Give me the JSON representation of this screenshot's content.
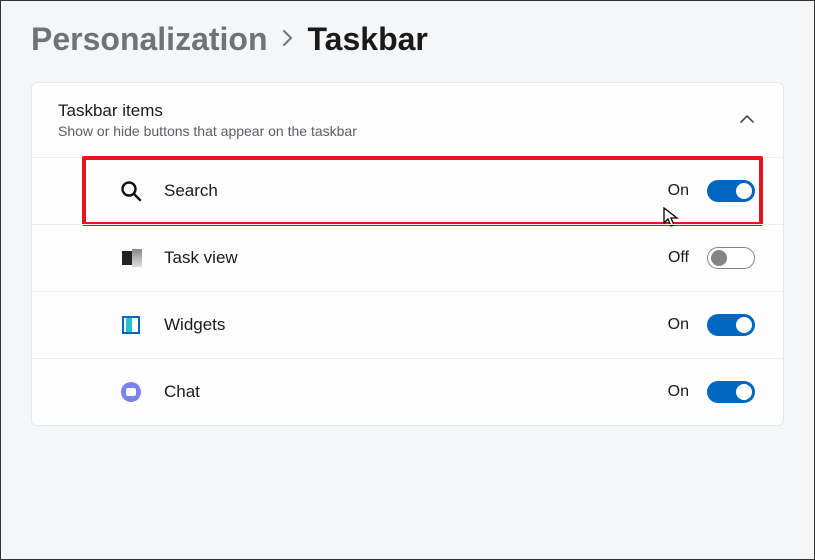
{
  "breadcrumb": {
    "parent": "Personalization",
    "current": "Taskbar"
  },
  "section": {
    "title": "Taskbar items",
    "subtitle": "Show or hide buttons that appear on the taskbar"
  },
  "stateLabels": {
    "on": "On",
    "off": "Off"
  },
  "items": [
    {
      "key": "search",
      "label": "Search",
      "on": true,
      "icon": "search-icon",
      "highlighted": true
    },
    {
      "key": "taskview",
      "label": "Task view",
      "on": false,
      "icon": "taskview-icon",
      "highlighted": false
    },
    {
      "key": "widgets",
      "label": "Widgets",
      "on": true,
      "icon": "widgets-icon",
      "highlighted": false
    },
    {
      "key": "chat",
      "label": "Chat",
      "on": true,
      "icon": "chat-icon",
      "highlighted": false
    }
  ]
}
